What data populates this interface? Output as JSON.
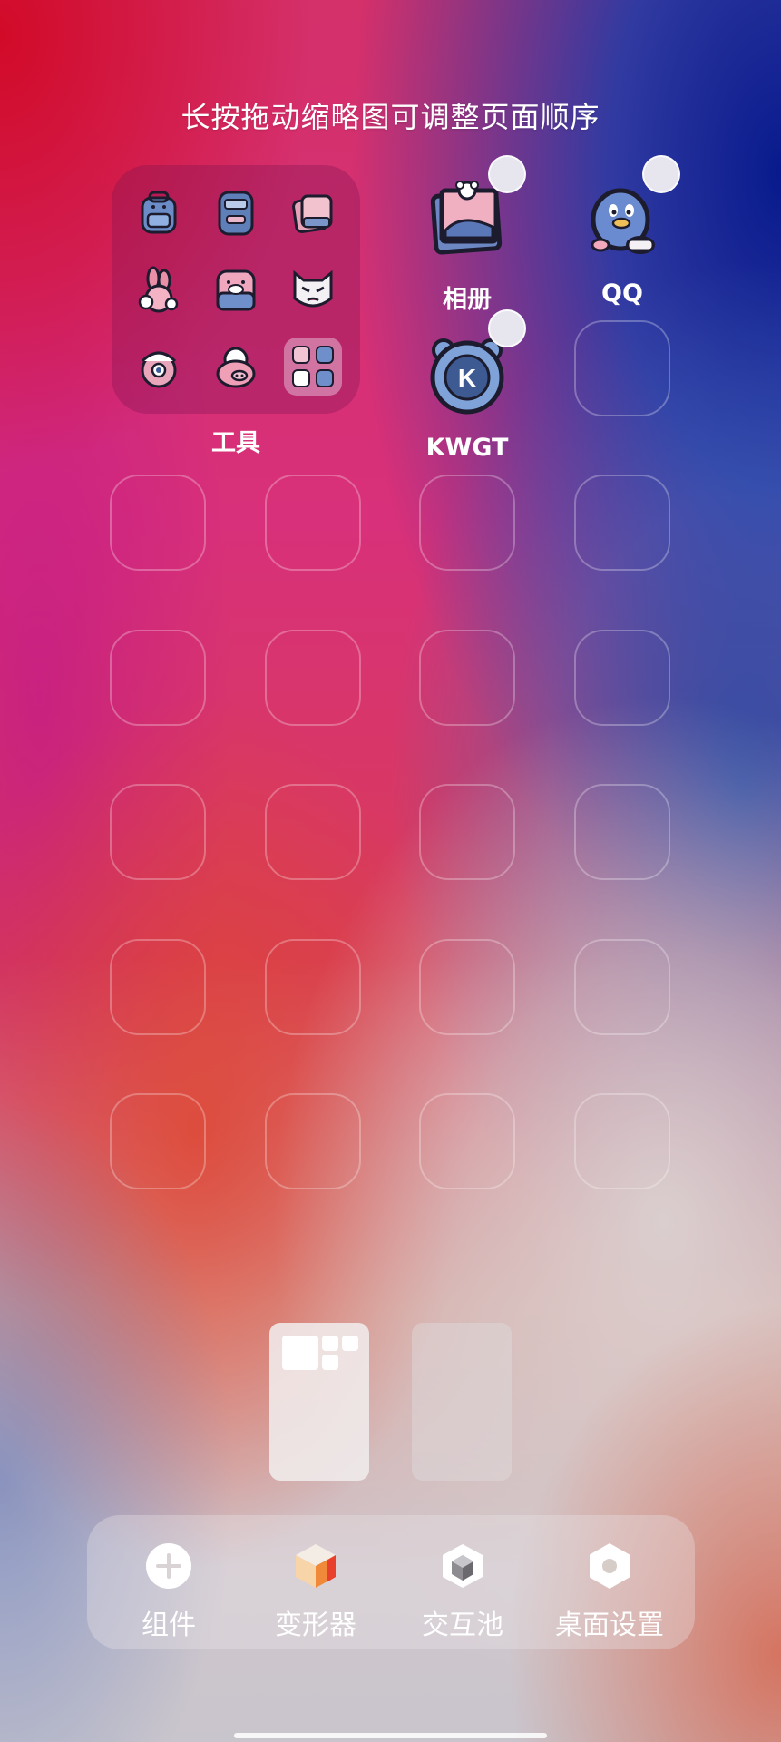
{
  "hint": "长按拖动缩略图可调整页面顺序",
  "folder": {
    "label": "工具",
    "icons": [
      "backpack-icon",
      "radio-icon",
      "books-icon",
      "bunny-icon",
      "pig-mug-icon",
      "cat-mask-icon",
      "bandaged-monster-icon",
      "pig-icon",
      "subfolder-icon"
    ]
  },
  "apps": [
    {
      "label": "相册",
      "icon": "photo-album-icon"
    },
    {
      "label": "QQ",
      "icon": "qq-penguin-icon"
    },
    {
      "label": "KWGT",
      "icon": "kwgt-icon",
      "glyph": "K"
    }
  ],
  "pages": {
    "count": 2,
    "active": 1
  },
  "dock": [
    {
      "label": "组件",
      "icon": "add-circle-icon"
    },
    {
      "label": "变形器",
      "icon": "transform-cube-icon"
    },
    {
      "label": "交互池",
      "icon": "interaction-cube-icon"
    },
    {
      "label": "桌面设置",
      "icon": "settings-hexagon-icon"
    }
  ]
}
